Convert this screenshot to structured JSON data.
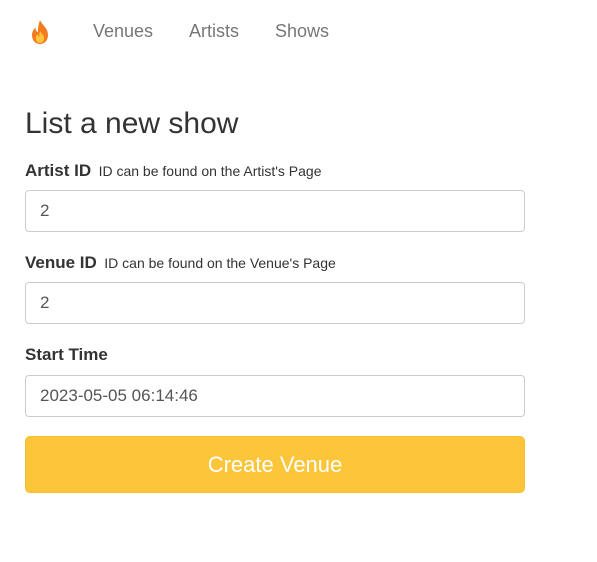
{
  "nav": {
    "logo_icon": "fire-icon",
    "items": [
      {
        "label": "Venues"
      },
      {
        "label": "Artists"
      },
      {
        "label": "Shows"
      }
    ]
  },
  "form": {
    "title": "List a new show",
    "artist": {
      "label": "Artist ID",
      "hint": "ID can be found on the Artist's Page",
      "value": "2"
    },
    "venue": {
      "label": "Venue ID",
      "hint": "ID can be found on the Venue's Page",
      "value": "2"
    },
    "start_time": {
      "label": "Start Time",
      "value": "2023-05-05 06:14:46"
    },
    "submit_label": "Create Venue"
  },
  "colors": {
    "button_bg": "#fdc53a",
    "button_text": "#ffffff",
    "nav_text": "#777777",
    "flame_outer": "#f37a1f",
    "flame_inner": "#fdc53a"
  }
}
